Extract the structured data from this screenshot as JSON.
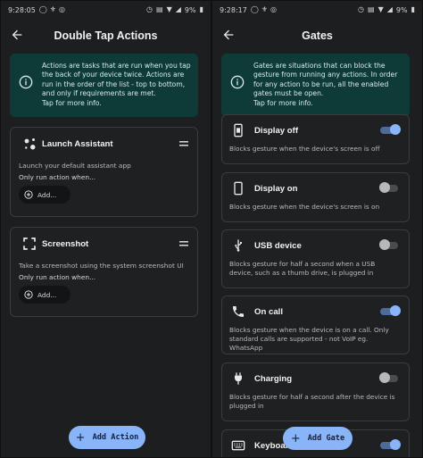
{
  "left": {
    "status": {
      "time": "9:28:05",
      "battery": "9%"
    },
    "title": "Double Tap Actions",
    "info": "Actions are tasks that are run when you tap the back of your device twice. Actions are run in the order of the list - top to bottom, and only if requirements are met.\nTap for more info.",
    "cards": [
      {
        "name": "Launch Assistant",
        "description": "Launch your default assistant app",
        "only_run": "Only run action when...",
        "add_label": "Add..."
      },
      {
        "name": "Screenshot",
        "description": "Take a screenshot using the system screenshot UI",
        "only_run": "Only run action when...",
        "add_label": "Add..."
      }
    ],
    "fab_label": "Add Action"
  },
  "right": {
    "status": {
      "time": "9:28:17",
      "battery": "9%"
    },
    "title": "Gates",
    "info": "Gates are situations that can block the gesture from running any actions. In order for any action to be run, all the enabled gates must be open.\nTap for more info.",
    "gates": [
      {
        "name": "Display off",
        "description": "Blocks gesture when the device's screen is off",
        "enabled": true,
        "icon": "phone-off-icon"
      },
      {
        "name": "Display on",
        "description": "Blocks gesture when the device's screen is on",
        "enabled": false,
        "icon": "phone-on-icon"
      },
      {
        "name": "USB device",
        "description": "Blocks gesture for half a second when a USB device, such as a thumb drive, is plugged in",
        "enabled": false,
        "icon": "usb-icon"
      },
      {
        "name": "On call",
        "description": "Blocks gesture when the device is on a call. Only standard calls are supported - not VoIP eg. WhatsApp",
        "enabled": true,
        "icon": "phone-call-icon"
      },
      {
        "name": "Charging",
        "description": "Blocks gesture for half a second after the device is plugged in",
        "enabled": false,
        "icon": "plug-icon"
      },
      {
        "name": "Keyboard",
        "description": "",
        "enabled": true,
        "icon": "keyboard-icon"
      }
    ],
    "fab_label": "Add Gate"
  },
  "colors": {
    "background": "#1d1e20",
    "info_bg": "#0e3b38",
    "accent": "#8ab4f8"
  }
}
